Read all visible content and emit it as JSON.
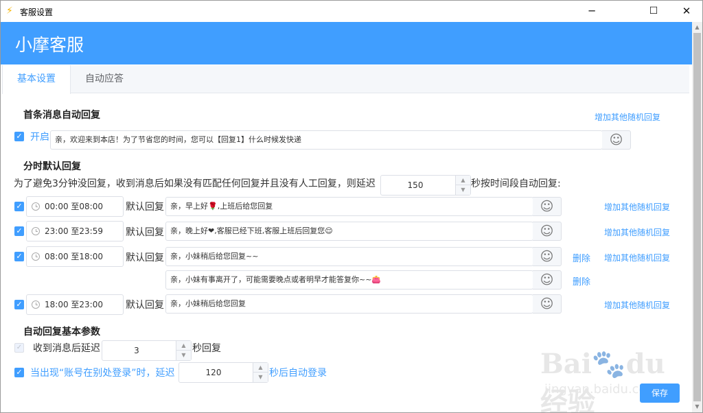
{
  "window": {
    "title": "客服设置",
    "app_icon": "lightning-icon",
    "min": "─",
    "max": "☐",
    "close": "✕"
  },
  "header": {
    "title": "小摩客服",
    "accent": "#409eff"
  },
  "tabs": [
    {
      "label": "基本设置",
      "active": true
    },
    {
      "label": "自动应答",
      "active": false
    }
  ],
  "first_msg": {
    "title": "首条消息自动回复",
    "add_link": "增加其他随机回复",
    "enable_label": "开启",
    "enabled": true,
    "message": "亲，欢迎来到本店！为了节省您的时间，您可以【回复1】什么时候发快递"
  },
  "timed": {
    "title": "分时默认回复",
    "desc_before": "为了避免3分钟没回复，收到消息后如果没有匹配任何回复并且没有人工回复，则延迟",
    "delay": "150",
    "desc_after": "秒按时间段自动回复:",
    "default_label": "默认回复",
    "add_link": "增加其他随机回复",
    "delete_label": "删除",
    "rows": [
      {
        "time": "00:00  至08:00",
        "checked": true,
        "messages": [
          "亲，早上好🌹,上班后给您回复"
        ],
        "show_delete": false
      },
      {
        "time": "23:00  至23:59",
        "checked": true,
        "messages": [
          "亲，晚上好❤,客服已经下班,客服上班后回复您😌"
        ],
        "show_delete": false
      },
      {
        "time": "08:00  至18:00",
        "checked": true,
        "messages": [
          "亲，小妹稍后给您回复~~",
          "亲，小妹有事离开了，可能需要晚点或者明早才能答复你~~👛"
        ],
        "show_delete": true
      },
      {
        "time": "18:00  至23:00",
        "checked": true,
        "messages": [
          "亲，小妹稍后给您回复"
        ],
        "show_delete": false
      }
    ]
  },
  "basic": {
    "title": "自动回复基本参数",
    "reply_prefix": "收到消息后延迟",
    "reply_delay": "3",
    "reply_suffix": "秒回复",
    "relogin_prefix": "当出现“账号在别处登录”时，延迟",
    "relogin_delay": "120",
    "relogin_suffix": "秒后自动登录"
  },
  "save_label": "保存",
  "watermark": {
    "logo": "Bai🐾du 经验",
    "url": "jingyan.baidu.com"
  }
}
